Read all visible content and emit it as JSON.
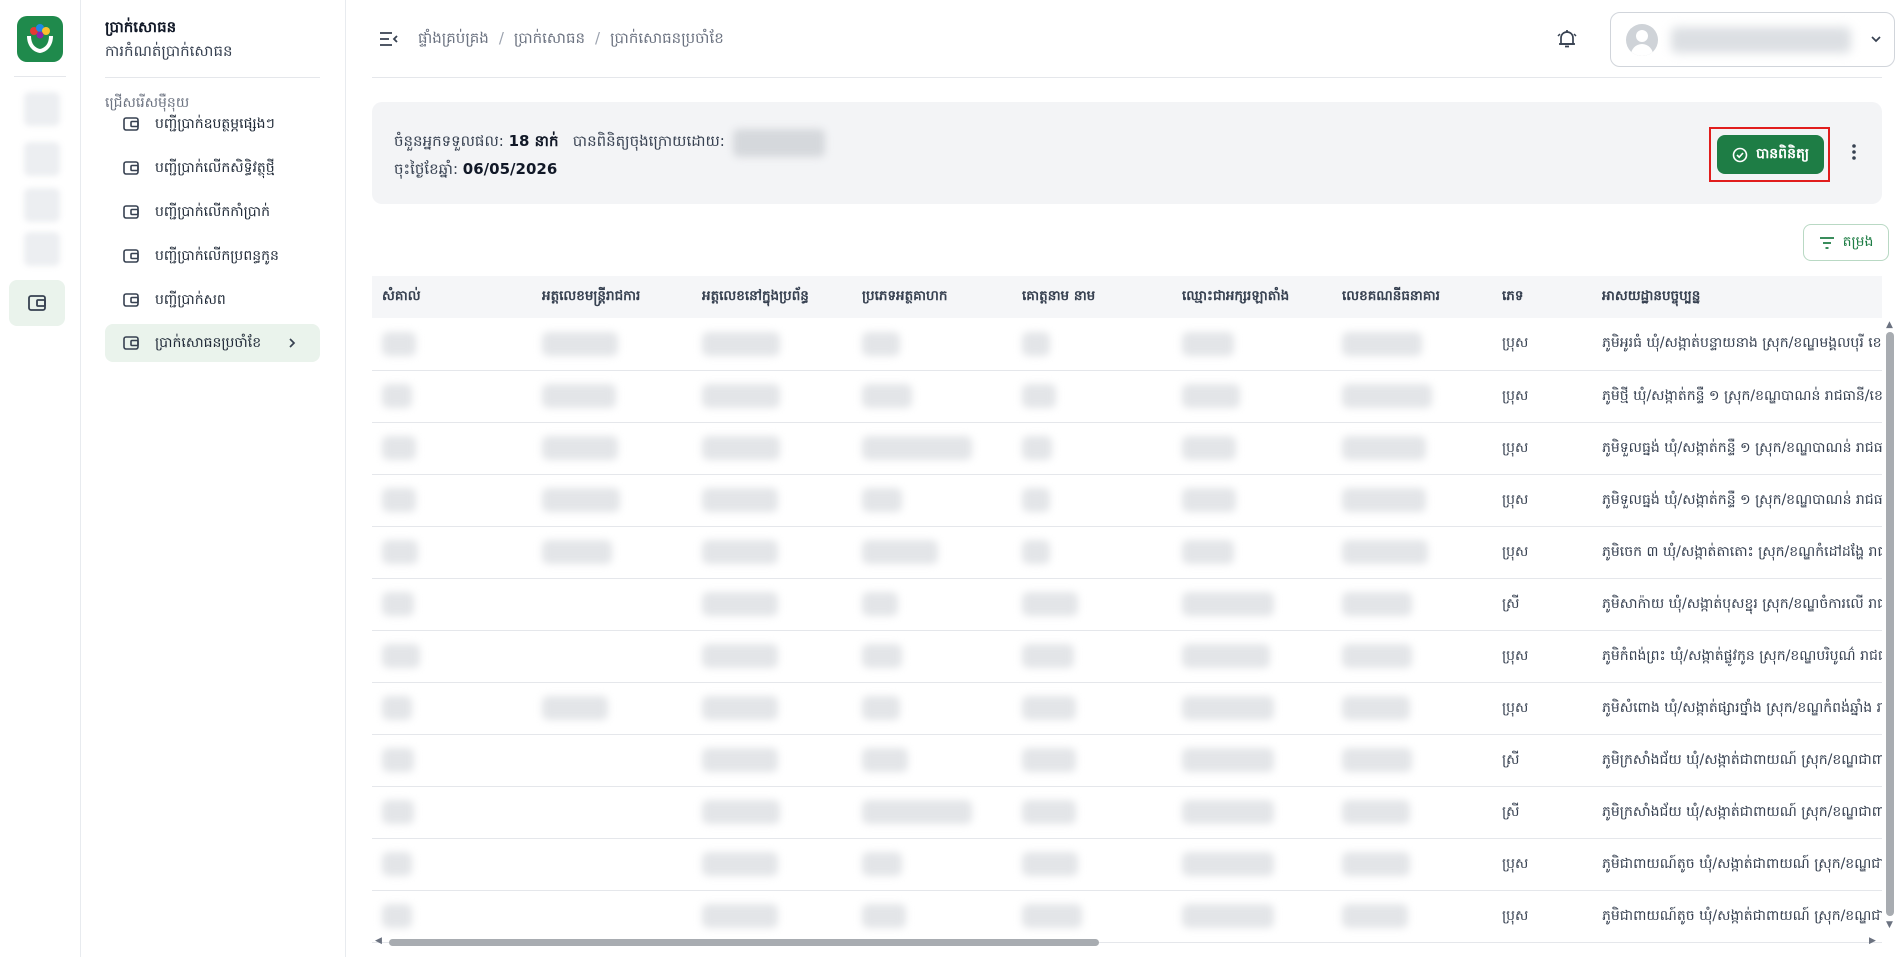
{
  "app": {
    "menu_title": "ប្រាក់សោធន",
    "menu_subtitle": "ការកំណត់ប្រាក់សោធន",
    "menu_section": "ជ្រើសរើសម៉ឺនុយ",
    "menu_items": [
      {
        "label": "បញ្ជីប្រាក់ឧបត្ថម្ភផ្សេងៗ",
        "icon": "wallet-icon"
      },
      {
        "label": "បញ្ជីប្រាក់លើកសិទ្ធិវត្ថុថ្មី",
        "icon": "wallet-icon"
      },
      {
        "label": "បញ្ជីប្រាក់លើកកាំប្រាក់",
        "icon": "wallet-icon"
      },
      {
        "label": "បញ្ជីប្រាក់លើកប្រពន្ធកូន",
        "icon": "wallet-icon"
      },
      {
        "label": "បញ្ជីប្រាក់សព",
        "icon": "wallet-icon"
      },
      {
        "label": "ប្រាក់សោធនប្រចាំខែ",
        "icon": "wallet-icon",
        "active": true
      }
    ]
  },
  "header": {
    "breadcrumb": [
      "ផ្ទាំងគ្រប់គ្រង",
      "ប្រាក់សោធន",
      "ប្រាក់សោធនប្រចាំខែ"
    ],
    "breadcrumb_separator": "/"
  },
  "summary": {
    "recipients_label": "ចំនួនអ្នកទទួលផល:",
    "recipients_value": "18 នាក់",
    "verified_by_label": "បានពិនិត្យចុងក្រោយដោយ:",
    "date_label": "ចុះថ្ងៃខែឆ្នាំ:",
    "date_value": "06/05/2026",
    "approve_button": "បានពិនិត្យ",
    "accent_color": "#1e7d45",
    "highlight_color": "#e11d1d"
  },
  "filter_button": "តម្រង",
  "table": {
    "columns": [
      "សំគាល់",
      "អត្តលេខមន្ត្រីរាជការ",
      "អត្តលេខនៅក្នុងប្រព័ន្ធ",
      "ប្រភេទអត្ថគាហក",
      "គោត្តនាម នាម",
      "ឈ្មោះជាអក្សរឡាតាំង",
      "លេខគណនីធនាគារ",
      "ភេទ",
      "អាសយដ្ឋានបច្ចុប្បន្ន"
    ],
    "rows": [
      {
        "gender": "ប្រុស",
        "address": "ភូមិអូរធំ ឃុំ/សង្កាត់បន្ទាយនាង ស្រុក/ខណ្ឌមង្គលបុរី ខេត្ត"
      },
      {
        "gender": "ប្រុស",
        "address": "ភូមិថ្មី ឃុំ/សង្កាត់កន្ទឺ ១ ស្រុក/ខណ្ឌបាណន់ រាជធានី/ខេ"
      },
      {
        "gender": "ប្រុស",
        "address": "ភូមិទួលធ្នង់ ឃុំ/សង្កាត់កន្ទឺ ១ ស្រុក/ខណ្ឌបាណន់ រាជធា"
      },
      {
        "gender": "ប្រុស",
        "address": "ភូមិទួលធ្នង់ ឃុំ/សង្កាត់កន្ទឺ ១ ស្រុក/ខណ្ឌបាណន់ រាជធា"
      },
      {
        "gender": "ប្រុស",
        "address": "ភូមិចេក ៣ ឃុំ/សង្កាត់តាតោះ ស្រុក/ខណ្ឌកំដៅដង្ហែ រាជធ"
      },
      {
        "gender": "ស្រី",
        "address": "ភូមិសាក៉ាយ ឃុំ/សង្កាត់បុសខ្នុរ ស្រុក/ខណ្ឌចំការលើ រាជធ"
      },
      {
        "gender": "ប្រុស",
        "address": "ភូមិកំពង់ព្រះ ឃុំ/សង្កាត់ផ្លូវកូន ស្រុក/ខណ្ឌបរិបូណ៌ រាជធ"
      },
      {
        "gender": "ប្រុស",
        "address": "ភូមិសំពោង ឃុំ/សង្កាត់ផ្សារថ្នាំង ស្រុក/ខណ្ឌកំពង់ឆ្នាំង រា"
      },
      {
        "gender": "ស្រី",
        "address": "ភូមិក្រសាំងជ័យ ឃុំ/សង្កាត់ជាពាយណ៍ ស្រុក/ខណ្ឌជាពា"
      },
      {
        "gender": "ស្រី",
        "address": "ភូមិក្រសាំងជ័យ ឃុំ/សង្កាត់ជាពាយណ៍ ស្រុក/ខណ្ឌជាពា"
      },
      {
        "gender": "ប្រុស",
        "address": "ភូមិជាពាយណ៍តូច ឃុំ/សង្កាត់ជាពាយណ៍ ស្រុក/ខណ្ឌជាពា"
      },
      {
        "gender": "ប្រុស",
        "address": "ភូមិជាពាយណ៍តូច ឃុំ/សង្កាត់ជាពាយណ៍ ស្រុក/ខណ្ឌជាពា"
      }
    ]
  }
}
